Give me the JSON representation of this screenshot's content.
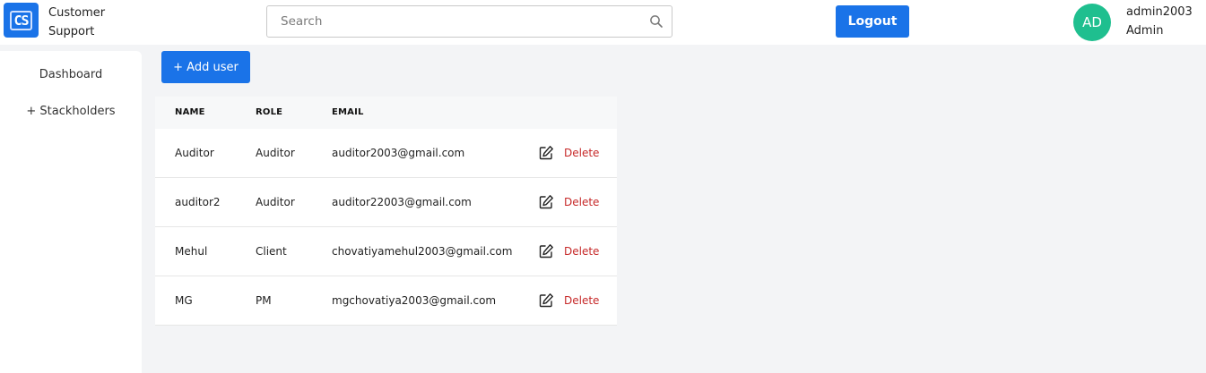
{
  "header": {
    "logo_text": "CS",
    "brand_line1": "Customer",
    "brand_line2": "Support",
    "search_placeholder": "Search",
    "logout_label": "Logout",
    "avatar_initials": "AD",
    "username": "admin2003",
    "user_role": "Admin"
  },
  "sidebar": {
    "items": [
      {
        "label": "Dashboard"
      },
      {
        "label": "+ Stackholders"
      }
    ]
  },
  "main": {
    "add_user_label": "+ Add user",
    "table": {
      "headers": {
        "name": "NAME",
        "role": "ROLE",
        "email": "EMAIL"
      },
      "delete_label": "Delete",
      "rows": [
        {
          "name": "Auditor",
          "role": "Auditor",
          "email": "auditor2003@gmail.com"
        },
        {
          "name": "auditor2",
          "role": "Auditor",
          "email": "auditor22003@gmail.com"
        },
        {
          "name": "Mehul",
          "role": "Client",
          "email": "chovatiyamehul2003@gmail.com"
        },
        {
          "name": "MG",
          "role": "PM",
          "email": "mgchovatiya2003@gmail.com"
        }
      ]
    }
  },
  "colors": {
    "primary": "#1a73e8",
    "avatar": "#1fbf8f",
    "delete": "#c62828",
    "background": "#f3f4f6"
  }
}
